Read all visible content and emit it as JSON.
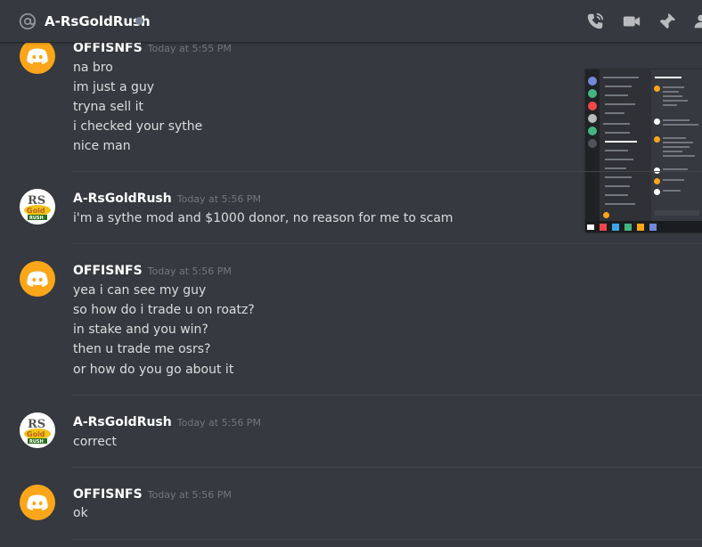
{
  "header": {
    "channel_name": "A-RsGoldRush",
    "icons": [
      "at-icon",
      "phone-call-icon",
      "video-camera-icon",
      "pin-icon",
      "members-icon"
    ]
  },
  "messages": [
    {
      "author": "OFFISNFS",
      "timestamp": "Today at 5:55 PM",
      "avatar": "discord-logo-icon",
      "lines": [
        "na bro",
        "im just a guy",
        "tryna sell it",
        "i checked your sythe",
        "nice man"
      ]
    },
    {
      "author": "A-RsGoldRush",
      "timestamp": "Today at 5:56 PM",
      "avatar": "rs-gold-rush-logo",
      "lines": [
        "i'm a sythe mod and $1000 donor, no reason for me to scam"
      ]
    },
    {
      "author": "OFFISNFS",
      "timestamp": "Today at 5:56 PM",
      "avatar": "discord-logo-icon",
      "lines": [
        "yea i can see my guy",
        "so how do i trade u on roatz?",
        "in stake and you win?",
        "then u trade me osrs?",
        "or how do you go about it"
      ]
    },
    {
      "author": "A-RsGoldRush",
      "timestamp": "Today at 5:56 PM",
      "avatar": "rs-gold-rush-logo",
      "lines": [
        "correct"
      ]
    },
    {
      "author": "OFFISNFS",
      "timestamp": "Today at 5:56 PM",
      "avatar": "discord-logo-icon",
      "lines": [
        "ok"
      ]
    }
  ],
  "colors": {
    "background": "#36393f",
    "discord_avatar": "#faa61a",
    "username": "#ffffff",
    "timestamp": "#72767d",
    "message_text": "#dcddde"
  }
}
